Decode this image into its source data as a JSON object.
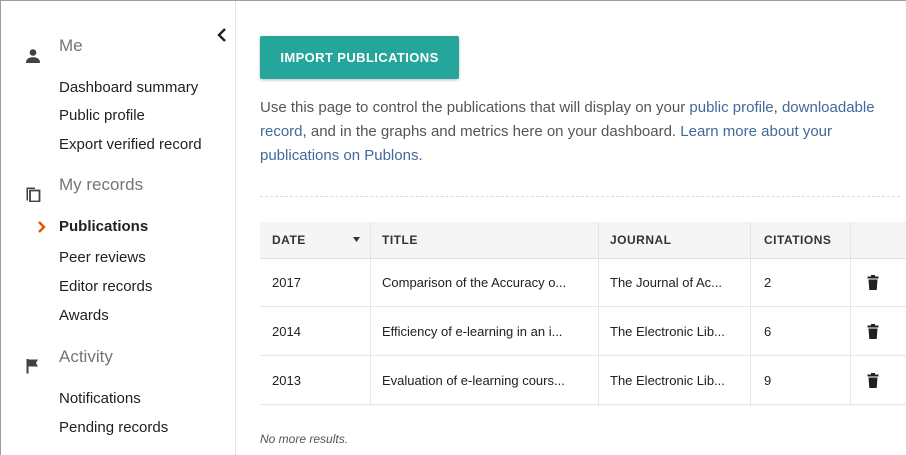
{
  "sidebar": {
    "sections": [
      {
        "title": "Me",
        "icon": "person-icon",
        "items": [
          "Dashboard summary",
          "Public profile",
          "Export verified record"
        ]
      },
      {
        "title": "My records",
        "icon": "copy-records-icon",
        "items": [
          "Publications",
          "Peer reviews",
          "Editor records",
          "Awards"
        ]
      },
      {
        "title": "Activity",
        "icon": "flag-icon",
        "items": [
          "Notifications",
          "Pending records"
        ]
      }
    ],
    "active_item": "Publications"
  },
  "main": {
    "import_button": "IMPORT PUBLICATIONS",
    "intro": {
      "t1": "Use this page to control the publications that will display on your ",
      "link1": "public profile",
      "t2": ", ",
      "link2": "downloadable record",
      "t3": ", and in the graphs and metrics here on your dashboard. ",
      "link3": "Learn more about your publications on Publons",
      "t4": "."
    },
    "table": {
      "columns": [
        "DATE",
        "TITLE",
        "JOURNAL",
        "CITATIONS"
      ],
      "sort_column": "DATE",
      "rows": [
        {
          "date": "2017",
          "title": "Comparison of the Accuracy o...",
          "journal": "The Journal of Ac...",
          "citations": "2"
        },
        {
          "date": "2014",
          "title": "Efficiency of e-learning in an i...",
          "journal": "The Electronic Lib...",
          "citations": "6"
        },
        {
          "date": "2013",
          "title": "Evaluation of e-learning cours...",
          "journal": "The Electronic Lib...",
          "citations": "9"
        }
      ]
    },
    "footer_note": "No more results."
  },
  "colors": {
    "accent": "#26a69a",
    "link": "#42699b",
    "active_chevron": "#e65100"
  }
}
